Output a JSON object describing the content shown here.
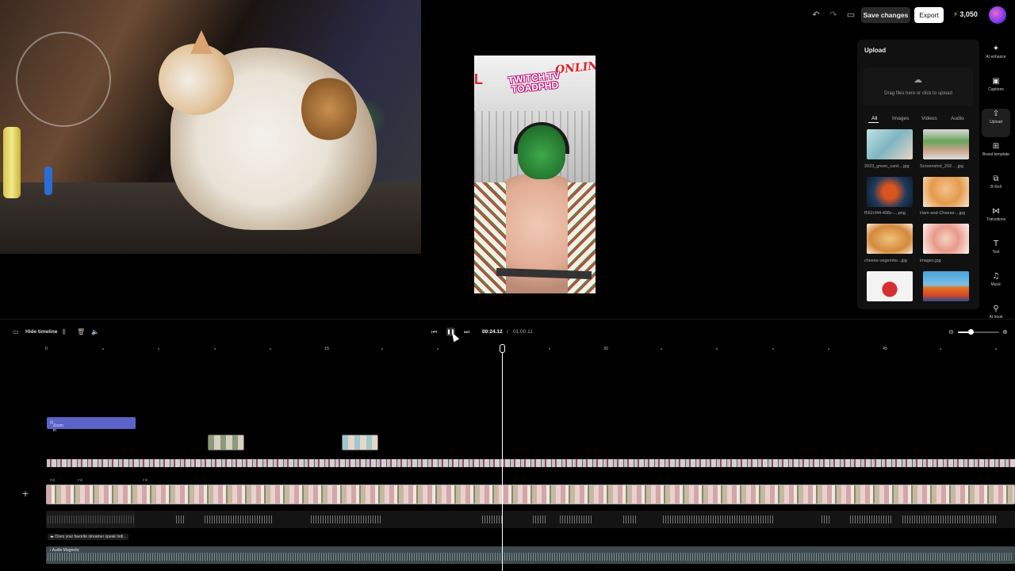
{
  "topbar": {
    "undo_icon": "undo-icon",
    "redo_icon": "redo-icon",
    "layout_icon": "monitor-icon",
    "save_label": "Save changes",
    "export_label": "Export",
    "credits": "3,050",
    "credits_icon": "bolt-icon"
  },
  "preview": {
    "overlay_text_main": "TWITCH.TV\nTOADPHD",
    "overlay_text_corner": "ONLIN",
    "overlay_text_left": "L"
  },
  "upload_panel": {
    "title": "Upload",
    "dropzone_text": "Drag files here or click to upload",
    "tabs": [
      "All",
      "Images",
      "Videos",
      "Audio"
    ],
    "active_tab": "All",
    "files": [
      {
        "name": "2023_green_card....jpg"
      },
      {
        "name": "Screenshot_202... .jpg"
      },
      {
        "name": "f562cf44-408c-....png"
      },
      {
        "name": "Ham-and-Cheese-...jpg"
      },
      {
        "name": "cheese-vegemite...jpg"
      },
      {
        "name": "images.jpg"
      },
      {
        "name": ""
      },
      {
        "name": ""
      }
    ]
  },
  "sidebar": {
    "items": [
      {
        "label": "AI enhance",
        "icon": "sparkle-icon"
      },
      {
        "label": "Captions",
        "icon": "captions-icon"
      },
      {
        "label": "Upload",
        "icon": "upload-icon"
      },
      {
        "label": "Brand template",
        "icon": "brand-icon"
      },
      {
        "label": "B-Roll",
        "icon": "broll-icon"
      },
      {
        "label": "Transitions",
        "icon": "transitions-icon"
      },
      {
        "label": "Text",
        "icon": "text-icon"
      },
      {
        "label": "Music",
        "icon": "music-icon"
      },
      {
        "label": "AI hook",
        "icon": "ai-hook-icon"
      }
    ],
    "active": "Upload"
  },
  "timeline": {
    "hide_label": "Hide timeline",
    "current_time": "00:24.12",
    "separator": "/",
    "total_time": "01:00.11",
    "ruler": [
      "0",
      "15",
      "30",
      "45"
    ],
    "zoom_clip_label": "Zoom in",
    "fill_labels": [
      "Fill",
      "Fill",
      "Fill"
    ],
    "caption_track_label": "Does your favorite streamer speak Indi...",
    "music_track_label": "Audio Magnetic",
    "zoom_level": 0.3
  },
  "colors": {
    "accent_zoom_clip": "#5b63c7",
    "export_bg": "#ffffff",
    "credits_bolt": "#f5c542"
  }
}
